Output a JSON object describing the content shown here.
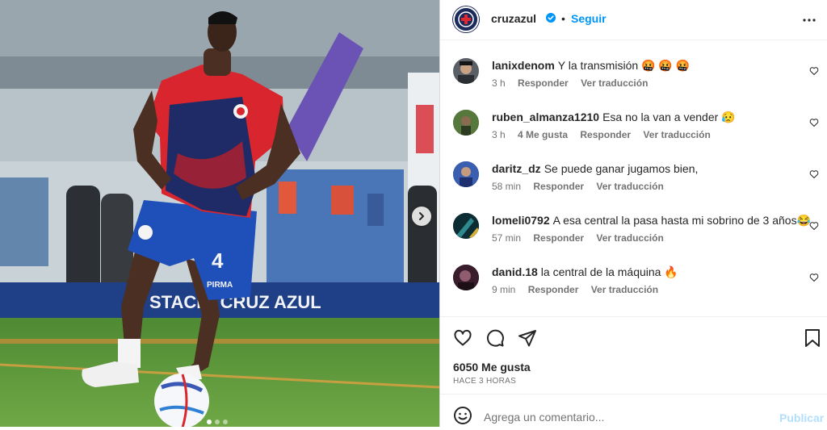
{
  "account": {
    "username": "cruzazul",
    "separator": "•",
    "follow_label": "Seguir",
    "verified_icon": "verified-badge-icon"
  },
  "media": {
    "slide_count": 3,
    "active_slide": 1,
    "jersey_number": "4",
    "sponsor": "PIRMA"
  },
  "comments": [
    {
      "user": "lanixdenom",
      "text": "Y la transmisión 🤬 🤬 🤬",
      "time": "3 h",
      "likes": "",
      "reply": "Responder",
      "translate": "Ver traducción"
    },
    {
      "user": "ruben_almanza1210",
      "text": "Esa no la van a vender 😥",
      "time": "3 h",
      "likes": "4 Me gusta",
      "reply": "Responder",
      "translate": "Ver traducción"
    },
    {
      "user": "daritz_dz",
      "text": "Se puede ganar jugamos bien,",
      "time": "58 min",
      "likes": "",
      "reply": "Responder",
      "translate": "Ver traducción"
    },
    {
      "user": "lomeli0792",
      "text": "A esa central la pasa hasta mi sobrino de 3 años😂",
      "time": "57 min",
      "likes": "",
      "reply": "Responder",
      "translate": "Ver traducción"
    },
    {
      "user": "danid.18",
      "text": "la central de la máquina 🔥",
      "time": "9 min",
      "likes": "",
      "reply": "Responder",
      "translate": "Ver traducción"
    }
  ],
  "stats": {
    "likes": "6050 Me gusta",
    "time_ago": "HACE 3 HORAS"
  },
  "composer": {
    "placeholder": "Agrega un comentario...",
    "publish_label": "Publicar"
  },
  "colors": {
    "accent": "#0095f6",
    "brand_navy": "#1b2a5c",
    "brand_red": "#e3262f",
    "publish_disabled": "#b2dffc"
  }
}
